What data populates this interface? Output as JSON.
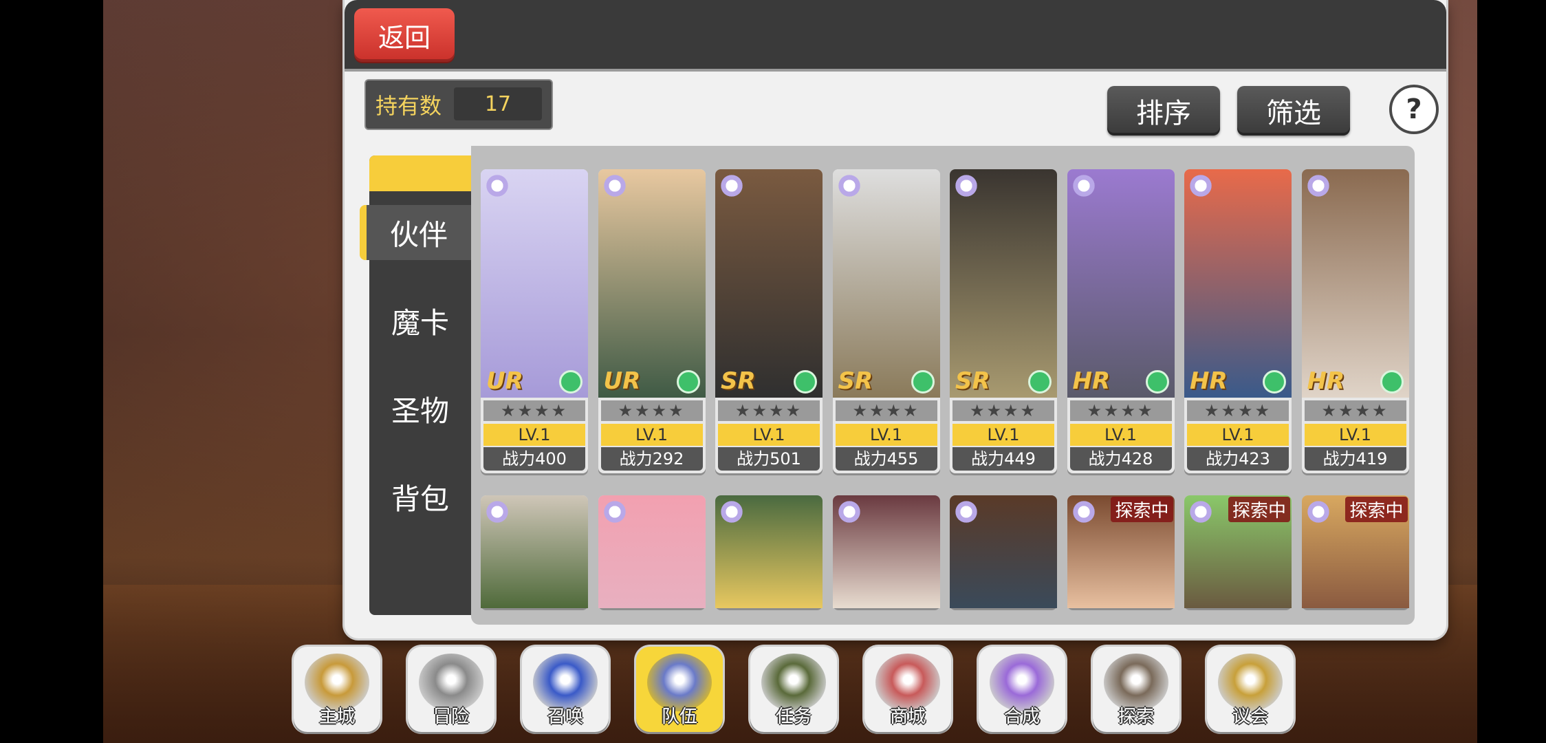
{
  "header": {
    "back_label": "返回"
  },
  "holdings": {
    "label": "持有数",
    "count": "17"
  },
  "toolbar": {
    "sort_label": "排序",
    "filter_label": "筛选",
    "help_label": "?"
  },
  "side_tabs": [
    {
      "label": "伙伴",
      "active": true
    },
    {
      "label": "魔卡",
      "active": false
    },
    {
      "label": "圣物",
      "active": false
    },
    {
      "label": "背包",
      "active": false
    }
  ],
  "cards_row1": [
    {
      "rarity": "UR",
      "stars": "★★★★",
      "level": "LV.1",
      "power": "战力400",
      "art": [
        "#d9d4f2",
        "#a69ad8"
      ]
    },
    {
      "rarity": "UR",
      "stars": "★★★★",
      "level": "LV.1",
      "power": "战力292",
      "art": [
        "#e8c8a0",
        "#3f5a45"
      ]
    },
    {
      "rarity": "SR",
      "stars": "★★★★",
      "level": "LV.1",
      "power": "战力501",
      "art": [
        "#7a5a40",
        "#2f2f2f"
      ]
    },
    {
      "rarity": "SR",
      "stars": "★★★★",
      "level": "LV.1",
      "power": "战力455",
      "art": [
        "#dedede",
        "#8a7a5a"
      ]
    },
    {
      "rarity": "SR",
      "stars": "★★★★",
      "level": "LV.1",
      "power": "战力449",
      "art": [
        "#3a3530",
        "#a89a70"
      ]
    },
    {
      "rarity": "HR",
      "stars": "★★★★",
      "level": "LV.1",
      "power": "战力428",
      "art": [
        "#9b7ad0",
        "#5a5a6a"
      ]
    },
    {
      "rarity": "HR",
      "stars": "★★★★",
      "level": "LV.1",
      "power": "战力423",
      "art": [
        "#e86a4a",
        "#3a5a8a"
      ]
    },
    {
      "rarity": "HR",
      "stars": "★★★★",
      "level": "LV.1",
      "power": "战力419",
      "art": [
        "#8a6a50",
        "#e0d4c8"
      ]
    }
  ],
  "cards_row2": [
    {
      "art": [
        "#cfc6b8",
        "#4f6a3a"
      ],
      "status": ""
    },
    {
      "art": [
        "#f2a0b0",
        "#e8b0c0"
      ],
      "status": ""
    },
    {
      "art": [
        "#4a6a40",
        "#e8c860"
      ],
      "status": ""
    },
    {
      "art": [
        "#6a3a40",
        "#e8dcd0"
      ],
      "status": ""
    },
    {
      "art": [
        "#5a3a28",
        "#3a4a5a"
      ],
      "status": ""
    },
    {
      "art": [
        "#7a4a30",
        "#e8c0a0"
      ],
      "status": "探索中"
    },
    {
      "art": [
        "#8ac86a",
        "#6a5a40"
      ],
      "status": "探索中"
    },
    {
      "art": [
        "#d8a860",
        "#8a5a40"
      ],
      "status": "探索中"
    }
  ],
  "nav": [
    {
      "label": "主城",
      "icon": "crown-icon",
      "color": "#c89a3a",
      "active": false
    },
    {
      "label": "冒险",
      "icon": "swords-icon",
      "color": "#8a8a8a",
      "active": false
    },
    {
      "label": "召唤",
      "icon": "summon-card-icon",
      "color": "#3a5ac8",
      "active": false
    },
    {
      "label": "队伍",
      "icon": "team-wings-icon",
      "color": "#6a7ac8",
      "active": true
    },
    {
      "label": "任务",
      "icon": "quest-book-icon",
      "color": "#5a6a3a",
      "active": false
    },
    {
      "label": "商城",
      "icon": "shop-tree-icon",
      "color": "#c85a5a",
      "active": false
    },
    {
      "label": "合成",
      "icon": "potion-icon",
      "color": "#9a6ad8",
      "active": false
    },
    {
      "label": "探索",
      "icon": "explore-shovel-icon",
      "color": "#7a6a5a",
      "active": false
    },
    {
      "label": "议会",
      "icon": "council-emblem-icon",
      "color": "#c8a03a",
      "active": false
    }
  ]
}
